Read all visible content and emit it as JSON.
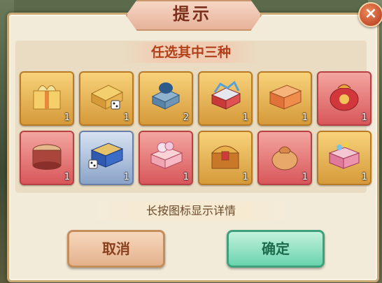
{
  "dialog": {
    "title": "提示",
    "subheader": "任选其中三种",
    "hint": "长按图标显示详情",
    "cancel_label": "取消",
    "confirm_label": "确定",
    "close_glyph": "×"
  },
  "items": [
    {
      "name": "golden-gift-box-icon",
      "count": "1",
      "style": "gold"
    },
    {
      "name": "gold-dice-box-icon",
      "count": "1",
      "style": "gold"
    },
    {
      "name": "blue-bird-box-icon",
      "count": "2",
      "style": "gold"
    },
    {
      "name": "red-treasure-chest-icon",
      "count": "1",
      "style": "gold"
    },
    {
      "name": "orange-chest-icon",
      "count": "1",
      "style": "gold"
    },
    {
      "name": "red-pouch-icon",
      "count": "1",
      "style": "red"
    },
    {
      "name": "octagon-box-icon",
      "count": "1",
      "style": "red"
    },
    {
      "name": "blue-dice-box-icon",
      "count": "1",
      "style": "blue"
    },
    {
      "name": "flower-gift-box-icon",
      "count": "1",
      "style": "red"
    },
    {
      "name": "golden-treasure-chest-icon",
      "count": "1",
      "style": "gold"
    },
    {
      "name": "gold-pouch-icon",
      "count": "1",
      "style": "red"
    },
    {
      "name": "jewel-chest-icon",
      "count": "1",
      "style": "gold"
    }
  ]
}
